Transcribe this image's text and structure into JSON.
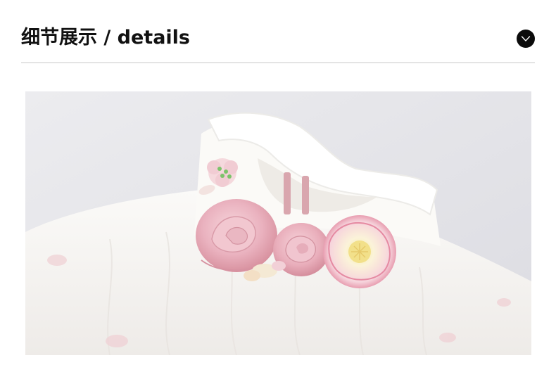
{
  "header": {
    "title": "细节展示 / details",
    "toggle_icon": "chevron-down-icon"
  },
  "photo": {
    "subject": "product-detail-photo",
    "colors": {
      "background": "#e6e6ea",
      "dress": "#f8f6f3",
      "rose": "#efb9c4",
      "flower_center": "#f3dd8a"
    }
  }
}
